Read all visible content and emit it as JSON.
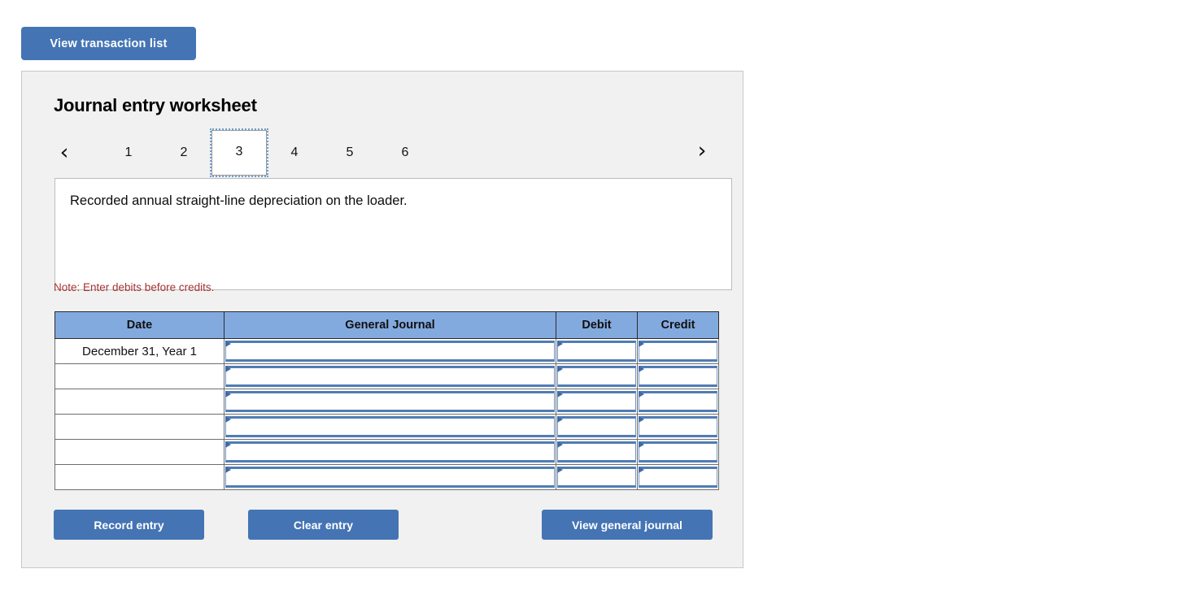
{
  "top_button": {
    "label": "View transaction list"
  },
  "panel": {
    "title": "Journal entry worksheet",
    "nav": {
      "prev_icon": "chevron-left-icon",
      "next_icon": "chevron-right-icon",
      "prev_glyph": "‹",
      "next_glyph": "›",
      "tabs": [
        {
          "label": "1",
          "active": false
        },
        {
          "label": "2",
          "active": false
        },
        {
          "label": "3",
          "active": true
        },
        {
          "label": "4",
          "active": false
        },
        {
          "label": "5",
          "active": false
        },
        {
          "label": "6",
          "active": false
        }
      ]
    },
    "description": "Recorded annual straight-line depreciation on the loader.",
    "note": "Note: Enter debits before credits.",
    "table": {
      "headers": [
        "Date",
        "General Journal",
        "Debit",
        "Credit"
      ],
      "rows": [
        {
          "date": "December 31, Year  1",
          "general_journal": "",
          "debit": "",
          "credit": ""
        },
        {
          "date": "",
          "general_journal": "",
          "debit": "",
          "credit": ""
        },
        {
          "date": "",
          "general_journal": "",
          "debit": "",
          "credit": ""
        },
        {
          "date": "",
          "general_journal": "",
          "debit": "",
          "credit": ""
        },
        {
          "date": "",
          "general_journal": "",
          "debit": "",
          "credit": ""
        },
        {
          "date": "",
          "general_journal": "",
          "debit": "",
          "credit": ""
        }
      ]
    },
    "actions": {
      "record": "Record entry",
      "clear": "Clear entry",
      "view_general_journal": "View general journal"
    }
  },
  "colors": {
    "button_blue": "#4474B4",
    "header_blue": "#83AADF",
    "note_red": "#A63232",
    "panel_bg": "#F1F1F1",
    "field_border_blue": "#4F7CB5"
  }
}
